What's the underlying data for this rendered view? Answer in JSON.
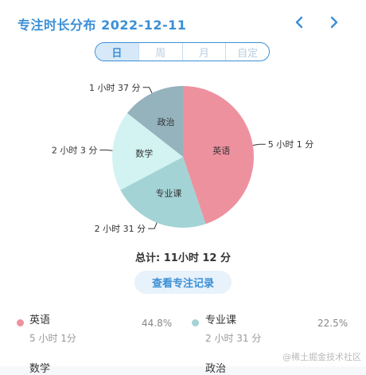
{
  "header": {
    "title": "专注时长分布 2022-12-11"
  },
  "tabs": [
    {
      "label": "日",
      "active": true
    },
    {
      "label": "周",
      "active": false
    },
    {
      "label": "月",
      "active": false
    },
    {
      "label": "自定",
      "active": false
    }
  ],
  "chart_data": {
    "type": "pie",
    "title": "",
    "slices": [
      {
        "label": "英语",
        "value": 301,
        "display": "5 小时 1 分",
        "color": "#ee919f"
      },
      {
        "label": "专业课",
        "value": 151,
        "display": "2 小时 31 分",
        "color": "#a3d3d5"
      },
      {
        "label": "数学",
        "value": 123,
        "display": "2 小时 3 分",
        "color": "#d3f3f3"
      },
      {
        "label": "政治",
        "value": 97,
        "display": "1 小时 37 分",
        "color": "#94b3bc"
      }
    ]
  },
  "total": {
    "text": "总计: 11小时 12 分"
  },
  "view_button": {
    "label": "查看专注记录"
  },
  "legend": [
    {
      "name": "英语",
      "duration": "5 小时 1分",
      "percent": "44.8%",
      "color": "#ee919f"
    },
    {
      "name": "专业课",
      "duration": "2 小时 31 分",
      "percent": "22.5%",
      "color": "#a3d3d5"
    },
    {
      "name": "数学",
      "duration": "",
      "percent": "",
      "color": "#d3f3f3"
    },
    {
      "name": "政治",
      "duration": "",
      "percent": "",
      "color": "#94b3bc"
    }
  ],
  "watermark": "@稀土掘金技术社区"
}
